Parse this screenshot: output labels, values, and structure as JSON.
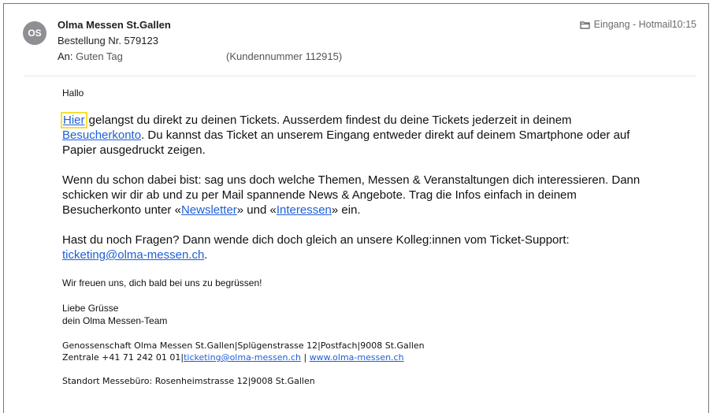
{
  "header": {
    "avatar_initials": "OS",
    "sender": "Olma Messen St.Gallen",
    "subject": "Bestellung Nr. 579123",
    "to_label": "An:",
    "to_value": "Guten Tag",
    "customer_number": "(Kundennummer 112915)",
    "folder": "Eingang - Hotmail",
    "time": "10:15"
  },
  "body": {
    "greeting": "Hallo",
    "p1_link_hier": "Hier",
    "p1_text_a": " gelangst du direkt zu deinen Tickets. Ausserdem findest du deine Tickets jederzeit in deinem",
    "p1_link_konto": "Besucherkonto",
    "p1_text_b": ". Du kannst das Ticket an unserem Eingang entweder direkt auf deinem Smartphone oder auf",
    "p1_text_c": "Papier ausgedruckt zeigen.",
    "p2_line1": "Wenn du schon dabei bist: sag uns doch welche Themen, Messen & Veranstaltungen dich interessieren. Dann",
    "p2_line2": "schicken wir dir ab und zu per Mail spannende News & Angebote. Trag die Infos einfach in deinem",
    "p2_text_a": "Besucherkonto unter «",
    "p2_link_newsletter": "Newsletter",
    "p2_text_b": "» und «",
    "p2_link_interessen": "Interessen",
    "p2_text_c": "» ein.",
    "p3_line1": "Hast du noch Fragen? Dann wende dich doch gleich an unsere Kolleg:innen vom Ticket-Support:",
    "p3_email": "ticketing@olma-messen.ch",
    "p3_dot": ".",
    "closing": "Wir freuen uns, dich bald bei uns zu begrüssen!",
    "regards1": "Liebe Grüsse",
    "regards2": "dein Olma Messen-Team"
  },
  "footer": {
    "line1": "Genossenschaft Olma Messen St.Gallen|Splügenstrasse 12|Postfach|9008 St.Gallen",
    "line2_prefix": "Zentrale +41 71 242 01 01|",
    "line2_email": "ticketing@olma-messen.ch",
    "line2_sep": " | ",
    "line2_web": "www.olma-messen.ch",
    "line3": "Standort Messebüro: Rosenheimstrasse 12|9008 St.Gallen"
  },
  "icons": {
    "folder": "folder-icon"
  },
  "colors": {
    "link": "#1f5fd6",
    "highlight": "#f5e032",
    "avatar": "#8e8e93"
  }
}
